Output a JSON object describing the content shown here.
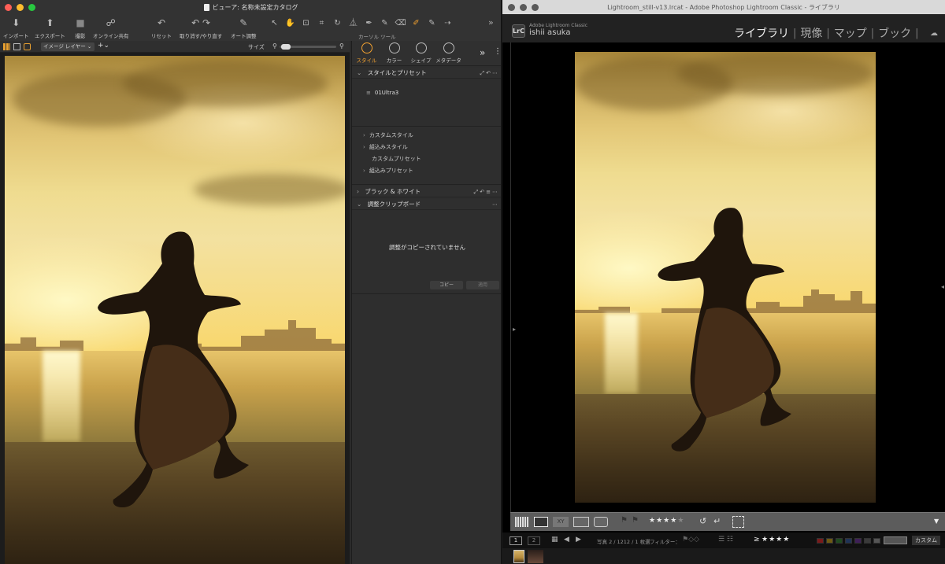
{
  "c1": {
    "window_title": "ビューア: 名称未設定カタログ",
    "toolbar": [
      {
        "label": "インポート",
        "icon": "import-icon",
        "glyph": "⬇"
      },
      {
        "label": "エクスポート",
        "icon": "export-icon",
        "glyph": "⬆"
      },
      {
        "label": "撮影",
        "icon": "camera-icon",
        "glyph": "■"
      },
      {
        "label": "オンライン共有",
        "icon": "share-icon",
        "glyph": "☍"
      },
      {
        "label": "リセット",
        "icon": "reset-icon",
        "glyph": "↶"
      },
      {
        "label": "取り消す/やり直す",
        "icon": "undo-redo-icon",
        "glyph": "↶ ↷"
      },
      {
        "label": "オート調整",
        "icon": "auto-adjust-icon",
        "glyph": "✎"
      }
    ],
    "cursor_tools_label": "カーソル ツール",
    "cursor_tools": [
      {
        "icon": "select-cursor-icon",
        "glyph": "↖"
      },
      {
        "icon": "pan-hand-icon",
        "glyph": "✋"
      },
      {
        "icon": "loupe-icon",
        "glyph": "⊡"
      },
      {
        "icon": "crop-icon",
        "glyph": "⌗"
      },
      {
        "icon": "rotate-icon",
        "glyph": "↻"
      },
      {
        "icon": "keystone-icon",
        "glyph": "⏅"
      },
      {
        "icon": "color-picker-icon",
        "glyph": "✒"
      },
      {
        "icon": "brush-icon",
        "glyph": "✎"
      },
      {
        "icon": "eraser-icon",
        "glyph": "⌫"
      },
      {
        "icon": "annotation-icon",
        "glyph": "✐"
      },
      {
        "icon": "wb-picker-icon",
        "glyph": "✎"
      },
      {
        "icon": "copy-apply-icon",
        "glyph": "⇢"
      }
    ],
    "layer_select": "イメージ レイヤー",
    "size_label": "サイズ",
    "tool_tabs": [
      {
        "label": "スタイル",
        "icon": "style-icon"
      },
      {
        "label": "カラー",
        "icon": "color-icon"
      },
      {
        "label": "シェイプ",
        "icon": "shape-icon"
      },
      {
        "label": "メタデータ",
        "icon": "metadata-icon"
      }
    ],
    "styles_section": {
      "title": "スタイルとプリセット",
      "preset": "01Ultra3",
      "items": [
        {
          "label": "カスタムスタイル",
          "chev": "›"
        },
        {
          "label": "組込みスタイル",
          "chev": "›"
        },
        {
          "label": "カスタムプリセット",
          "chev": ""
        },
        {
          "label": "組込みプリセット",
          "chev": "›"
        }
      ]
    },
    "bw_section": {
      "title": "ブラック & ホワイト"
    },
    "clipboard_section": {
      "title": "調整クリップボード",
      "empty_message": "調整がコピーされていません",
      "copy_label": "コピー",
      "apply_label": "適用"
    }
  },
  "lr": {
    "window_title": "Lightroom_still-v13.lrcat - Adobe Photoshop Lightroom Classic - ライブラリ",
    "badge": "LrC",
    "brand": "Adobe Lightroom Classic",
    "user": "ishii asuka",
    "modules": [
      {
        "label": "ライブラリ",
        "active": true
      },
      {
        "label": "現像",
        "active": false
      },
      {
        "label": "マップ",
        "active": false
      },
      {
        "label": "ブック",
        "active": false
      }
    ],
    "rating": 4,
    "rating_max": 5,
    "filmstrip": {
      "screen1": "1",
      "screen2": "2",
      "photo_info": "写真 2 / 1212 / 1 枚選",
      "filter_label": "フィルター：",
      "filter_op": "≥",
      "filter_stars": 4,
      "custom_label": "カスタム",
      "swatches": [
        "#7a1a1a",
        "#6e5a12",
        "#1f4a1f",
        "#1f3357",
        "#3e1f57",
        "#3a3a3a",
        "#555555"
      ]
    }
  }
}
